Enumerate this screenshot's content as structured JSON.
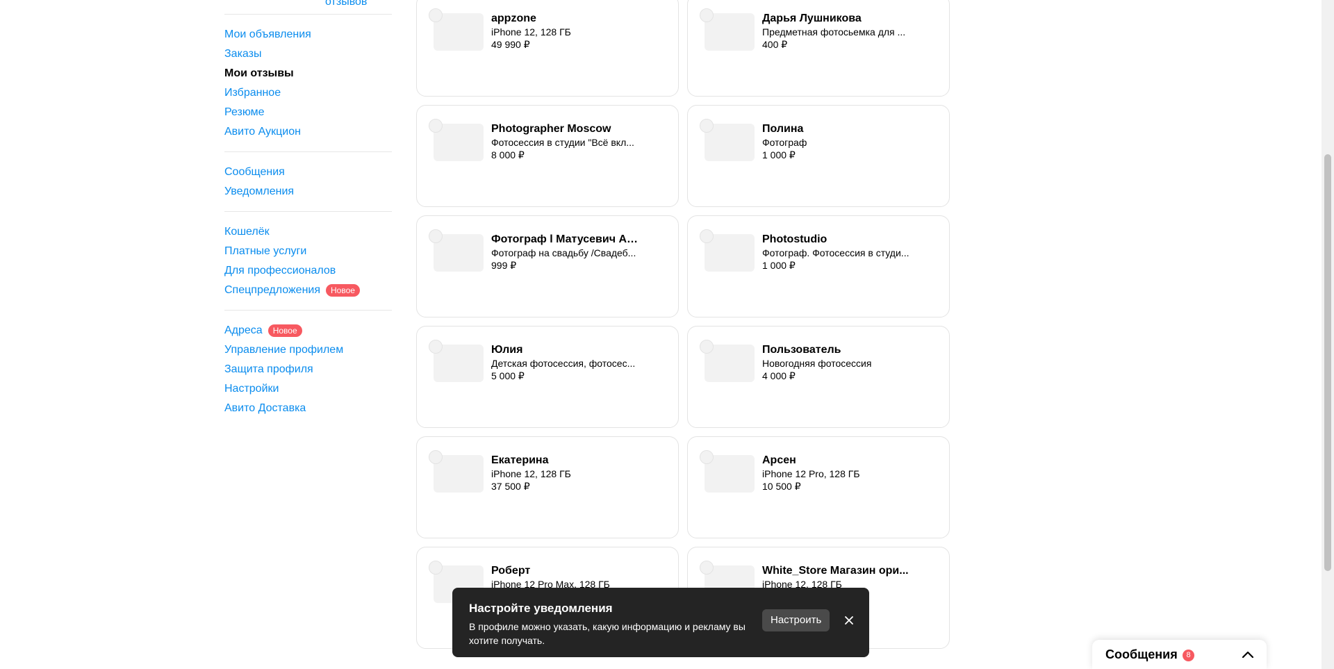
{
  "sidebar": {
    "top_link": "отзывов",
    "group1": [
      {
        "label": "Мои объявления"
      },
      {
        "label": "Заказы"
      },
      {
        "label": "Мои отзывы",
        "active": true
      },
      {
        "label": "Избранное"
      },
      {
        "label": "Резюме"
      },
      {
        "label": "Авито Аукцион"
      }
    ],
    "group2": [
      {
        "label": "Сообщения"
      },
      {
        "label": "Уведомления"
      }
    ],
    "group3": [
      {
        "label": "Кошелёк"
      },
      {
        "label": "Платные услуги"
      },
      {
        "label": "Для профессионалов"
      },
      {
        "label": "Спецпредложения",
        "badge": "Новое"
      }
    ],
    "group4": [
      {
        "label": "Адреса",
        "badge": "Новое"
      },
      {
        "label": "Управление профилем"
      },
      {
        "label": "Защита профиля"
      },
      {
        "label": "Настройки"
      },
      {
        "label": "Авито Доставка"
      }
    ]
  },
  "cards": [
    {
      "name": "appzone",
      "title": "iPhone 12, 128 ГБ",
      "price": "49 990 ₽"
    },
    {
      "name": "Дарья Лушникова",
      "title": "Предметная фотосьемка для ...",
      "price": "400 ₽"
    },
    {
      "name": "Photographer Moscow",
      "title": "Фотосессия в студии \"Всё вкл...",
      "price": "8 000 ₽"
    },
    {
      "name": "Полина",
      "title": "Фотограф",
      "price": "1 000 ₽"
    },
    {
      "name": "Фотограф l Матусевич Ан...",
      "title": "Фотограф на свадьбу /Свадеб...",
      "price": "999 ₽"
    },
    {
      "name": "Photostudio",
      "title": "Фотограф. Фотосессия в студи...",
      "price": "1 000 ₽"
    },
    {
      "name": "Юлия",
      "title": "Детская фотосессия, фотосес...",
      "price": "5 000 ₽"
    },
    {
      "name": "Пользователь",
      "title": "Новогодняя фотосессия",
      "price": "4 000 ₽"
    },
    {
      "name": "Екатерина",
      "title": "iPhone 12, 128 ГБ",
      "price": "37 500 ₽"
    },
    {
      "name": "Арсен",
      "title": "iPhone 12 Pro, 128 ГБ",
      "price": "10 500 ₽"
    },
    {
      "name": "Роберт",
      "title": "iPhone 12 Pro Max, 128 ГБ",
      "price": ""
    },
    {
      "name": "White_Store Магазин ори...",
      "title": "iPhone 12, 128 ГБ",
      "price": ""
    }
  ],
  "toast": {
    "title": "Настройте уведомления",
    "text": "В профиле можно указать, какую информацию и рекламу вы хотите получать.",
    "button": "Настроить",
    "close_icon": "close-icon"
  },
  "messages": {
    "label": "Сообщения",
    "count": "8",
    "icon": "chevron-up-icon"
  },
  "colors": {
    "link": "#0a8cee",
    "badge": "#f75960",
    "toast_bg": "#242424"
  }
}
